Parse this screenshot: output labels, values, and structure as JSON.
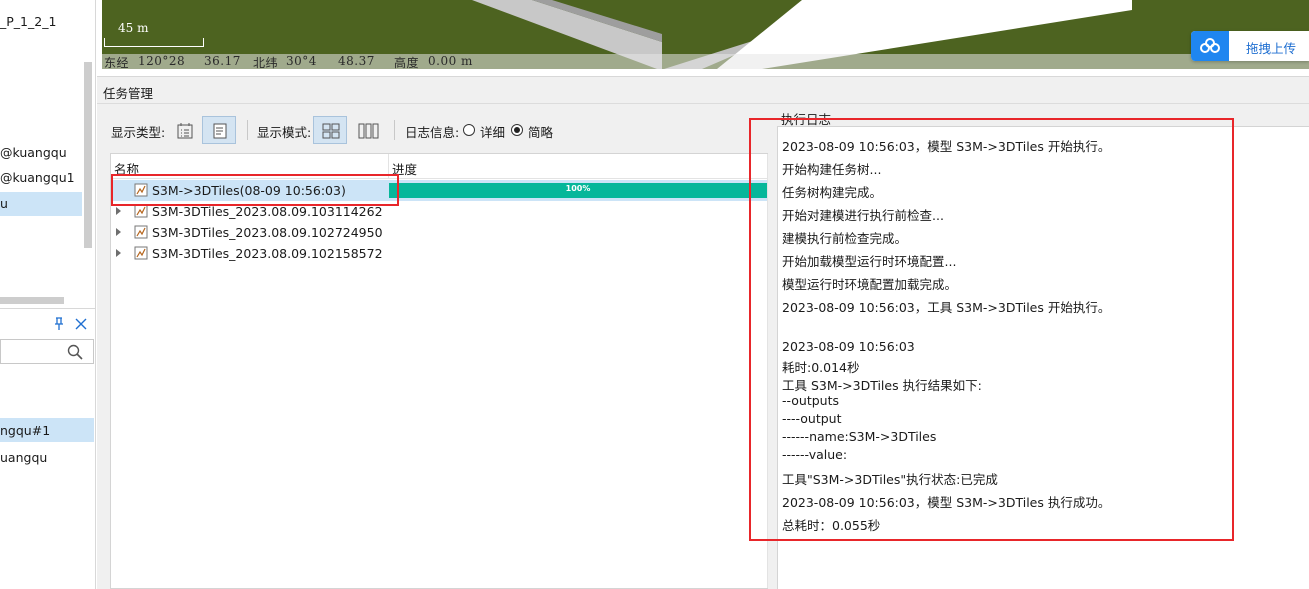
{
  "left_panel": {
    "items_top": [
      "_P_1_2_1"
    ],
    "items_mid": [
      "@kuangqu",
      "@kuangqu1",
      "u"
    ],
    "items_bottom": [
      "ngqu#1",
      "uangqu"
    ]
  },
  "map": {
    "scale_label": "45 m",
    "status": {
      "lon_label": "东经",
      "lon_deg": "120°28",
      "lon_sec": "36.17",
      "lat_label": "北纬",
      "lat_deg": "30°4",
      "lat_sec": "48.37",
      "alt_label": "高度",
      "alt_value": "0.00 m"
    },
    "colors": {
      "ground": "#4d6320",
      "road": "#c8c8c8"
    }
  },
  "upload_widget": {
    "label": "拖拽上传",
    "icon": "cloud-icon",
    "color": "#1f86f0"
  },
  "task_panel": {
    "title": "任务管理",
    "toolbar": {
      "display_type_label": "显示类型:",
      "display_mode_label": "显示模式:",
      "log_info_label": "日志信息:",
      "radio_detail": "详细",
      "radio_brief": "简略",
      "selected_radio": "简略"
    },
    "grid": {
      "col_name": "名称",
      "col_progress": "进度",
      "rows": [
        {
          "name": "S3M->3DTiles(08-09 10:56:03)",
          "progress_pct": 100,
          "progress_text": "100%"
        },
        {
          "name": "S3M-3DTiles_2023.08.09.103114262"
        },
        {
          "name": "S3M-3DTiles_2023.08.09.102724950"
        },
        {
          "name": "S3M-3DTiles_2023.08.09.102158572"
        }
      ]
    },
    "log": {
      "title": "执行日志",
      "lines": [
        "2023-08-09 10:56:03，模型 S3M->3DTiles 开始执行。",
        "开始构建任务树...",
        "任务树构建完成。",
        "开始对建模进行执行前检查...",
        "建模执行前检查完成。",
        "开始加载模型运行时环境配置...",
        "模型运行时环境配置加载完成。",
        "2023-08-09 10:56:03，工具 S3M->3DTiles 开始执行。",
        "2023-08-09 10:56:03",
        "耗时:0.014秒",
        "工具 S3M->3DTiles 执行结果如下:",
        "--outputs",
        "----output",
        "------name:S3M->3DTiles",
        "------value:",
        "工具\"S3M->3DTiles\"执行状态:已完成",
        "2023-08-09 10:56:03，模型 S3M->3DTiles 执行成功。",
        "总耗时：0.055秒"
      ]
    },
    "colors": {
      "progress": "#06b79a",
      "selection": "#cce4f7",
      "highlight": "#e8262a"
    }
  }
}
